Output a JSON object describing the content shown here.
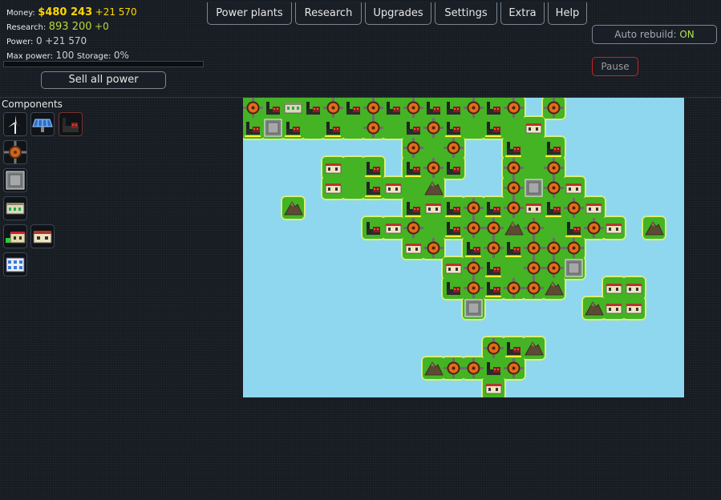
{
  "stats": {
    "money_label": "Money:",
    "money_value": "$480 243",
    "money_delta": "+21 570",
    "research_label": "Research:",
    "research_value": "893 200",
    "research_delta": "+0",
    "power_label": "Power:",
    "power_value": "0",
    "power_delta": "+21 570",
    "max_power_label": "Max power:",
    "max_power_value": "100",
    "storage_label": "Storage:",
    "storage_value": "0%",
    "storage_fill": 0
  },
  "buttons": {
    "sell_all_power": "Sell all power",
    "auto_rebuild_label": "Auto rebuild:",
    "auto_rebuild_state": "ON",
    "pause": "Pause"
  },
  "nav": [
    "Power plants",
    "Research",
    "Upgrades",
    "Settings",
    "Extra",
    "Help"
  ],
  "components": {
    "title": "Components",
    "items": [
      "wind-turbine-icon",
      "solar-panel-icon",
      "coal-plant-icon",
      "heat-exchanger-icon",
      "battery-icon",
      "power-office-icon",
      "upgraded-office-icon",
      "house-icon",
      "research-center-icon"
    ]
  },
  "map": {
    "cols": 22,
    "rows": 15,
    "colors": {
      "water": "#8ed7ef",
      "grass": "#44b324",
      "coast": "#d9f07a",
      "accent": "#e36a1d"
    },
    "grid": [
      "ecxcecececcece.e......",
      "CBCgCgegceCgCgh.......",
      "........ege..CgC......",
      "....hgC.Cec..ege......",
      "....hgChgA...eBeh.....",
      "..m.....ChCeCehCeh....",
      "......chegCeeAegCeh.A.",
      "........he.CeCeee.....",
      "..........heCgeeB.....",
      "..........ceCeeA..hh..",
      "...........B.....Ahh..",
      "......................",
      "............eCA.......",
      ".........Aeece........",
      "............h........."
    ]
  }
}
